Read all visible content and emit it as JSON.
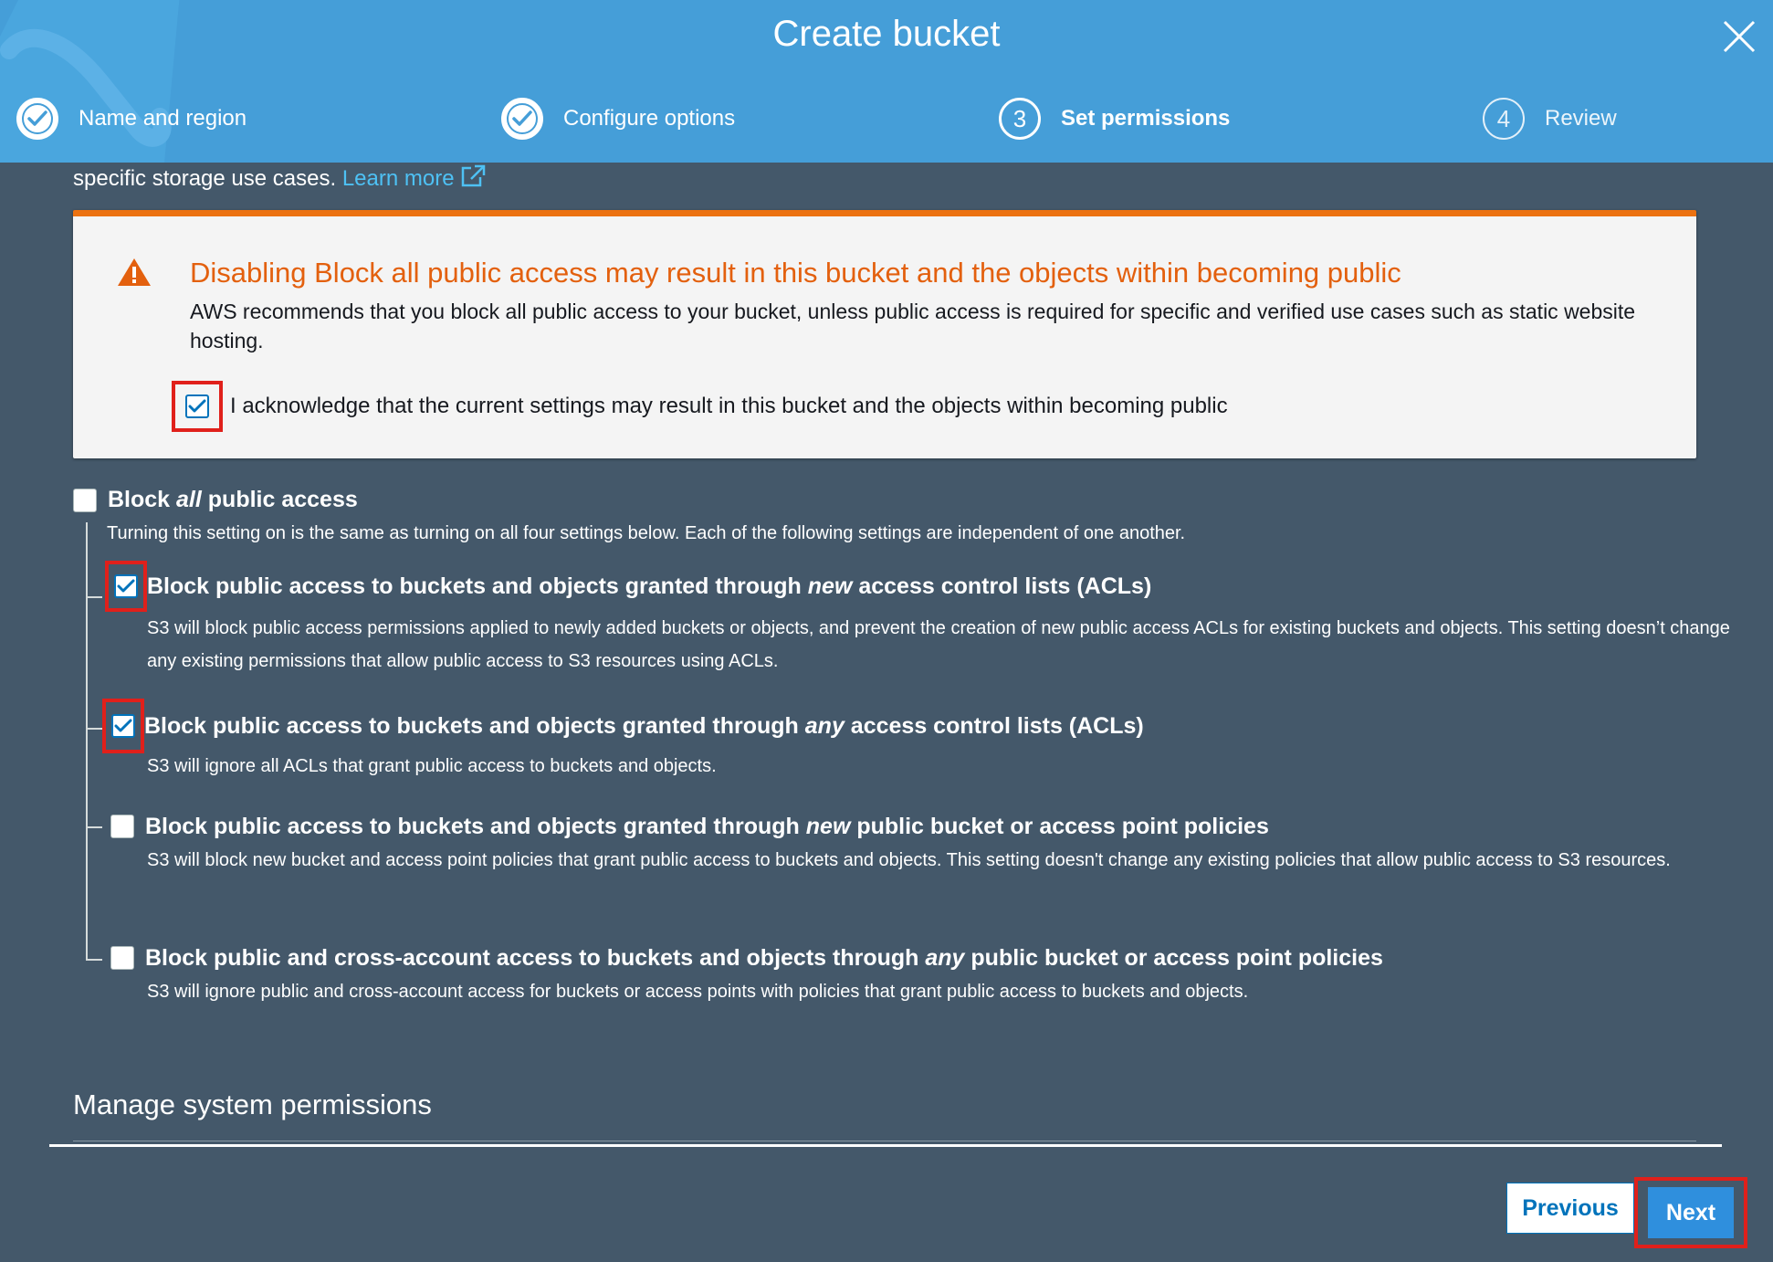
{
  "header": {
    "title": "Create bucket",
    "steps": [
      {
        "number": "1",
        "label": "Name and region",
        "status": "complete"
      },
      {
        "number": "2",
        "label": "Configure options",
        "status": "complete"
      },
      {
        "number": "3",
        "label": "Set permissions",
        "status": "current"
      },
      {
        "number": "4",
        "label": "Review",
        "status": "upcoming"
      }
    ]
  },
  "intro": {
    "text": "specific storage use cases. ",
    "link": "Learn more"
  },
  "warning": {
    "title": "Disabling Block all public access may result in this bucket and the objects within becoming public",
    "body": "AWS recommends that you block all public access to your bucket, unless public access is required for specific and verified use cases such as static website hosting.",
    "ack_label": "I acknowledge that the current settings may result in this bucket and the objects within becoming public",
    "ack_checked": true
  },
  "block_all": {
    "label_prefix": "Block ",
    "label_em": "all",
    "label_suffix": " public access",
    "checked": false,
    "description": "Turning this setting on is the same as turning on all four settings below. Each of the following settings are independent of one another."
  },
  "options": [
    {
      "title_prefix": "Block public access to buckets and objects granted through ",
      "title_em": "new",
      "title_suffix": " access control lists (ACLs)",
      "description": "S3 will block public access permissions applied to newly added buckets or objects, and prevent the creation of new public access ACLs for existing buckets and objects. This setting doesn’t change any existing permissions that allow public access to S3 resources using ACLs.",
      "checked": true
    },
    {
      "title_prefix": "Block public access to buckets and objects granted through ",
      "title_em": "any",
      "title_suffix": " access control lists (ACLs)",
      "description": "S3 will ignore all ACLs that grant public access to buckets and objects.",
      "checked": true
    },
    {
      "title_prefix": "Block public access to buckets and objects granted through ",
      "title_em": "new",
      "title_suffix": " public bucket or access point policies",
      "description": "S3 will block new bucket and access point policies that grant public access to buckets and objects. This setting doesn't change any existing policies that allow public access to S3 resources.",
      "checked": false
    },
    {
      "title_prefix": "Block public and cross-account access to buckets and objects through ",
      "title_em": "any",
      "title_suffix": " public bucket or access point policies",
      "description": "S3 will ignore public and cross-account access for buckets or access points with policies that grant public access to buckets and objects.",
      "checked": false
    }
  ],
  "manage_section": {
    "title": "Manage system permissions"
  },
  "footer": {
    "previous_label": "Previous",
    "next_label": "Next"
  },
  "colors": {
    "header_bg": "#459ed8",
    "page_bg": "#44586a",
    "warning_accent": "#ec7211",
    "warning_title": "#e3600e",
    "link": "#4ec1f4",
    "primary": "#2f8fdd",
    "highlight": "#e0201b"
  }
}
